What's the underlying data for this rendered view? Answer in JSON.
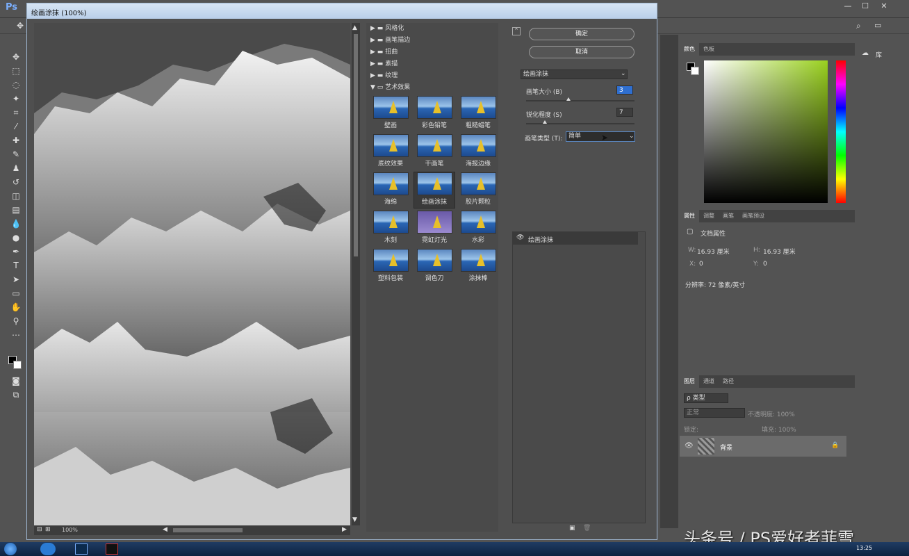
{
  "ps": {
    "logo": "Ps",
    "controls": {
      "min": "—",
      "max": "☐",
      "close": "✕"
    }
  },
  "dialog": {
    "title": "绘画涂抹 (100%)",
    "zoom": "100%",
    "folders": [
      "风格化",
      "画笔描边",
      "扭曲",
      "素描",
      "纹理",
      "艺术效果"
    ],
    "filters": [
      "壁画",
      "彩色铅笔",
      "粗糙蜡笔",
      "底纹效果",
      "干画笔",
      "海报边缘",
      "海绵",
      "绘画涂抹",
      "胶片颗粒",
      "木刻",
      "霓虹灯光",
      "水彩",
      "塑料包装",
      "调色刀",
      "涂抹棒"
    ],
    "selected_filter": "绘画涂抹",
    "ok": "确定",
    "cancel": "取消",
    "filter_select": "绘画涂抹",
    "brush_size_label": "画笔大小 (B)",
    "brush_size": "3",
    "sharpness_label": "锐化程度 (S)",
    "sharpness": "7",
    "brush_type_label": "画笔类型 (T):",
    "brush_type": "简单",
    "layer_item": "绘画涂抹"
  },
  "color_panel": {
    "tabs": [
      "颜色",
      "色板"
    ]
  },
  "props_panel": {
    "tabs": [
      "属性",
      "调整",
      "画笔",
      "画笔预设"
    ],
    "title": "文档属性",
    "w_label": "W:",
    "w": "16.93 厘米",
    "h_label": "H:",
    "h": "16.93 厘米",
    "x_label": "X:",
    "x": "0",
    "y_label": "Y:",
    "y": "0",
    "resolution": "分辨率: 72 像素/英寸"
  },
  "layers_panel": {
    "tabs": [
      "图层",
      "通道",
      "路径"
    ],
    "kind": "ρ 类型",
    "mode": "正常",
    "opacity": "不透明度: 100%",
    "lock": "锁定:",
    "fill": "填充: 100%",
    "layer_name": "背景"
  },
  "side": {
    "lib": "库"
  },
  "watermark": "头条号 / PS爱好者菲雪",
  "clock": "13:25"
}
